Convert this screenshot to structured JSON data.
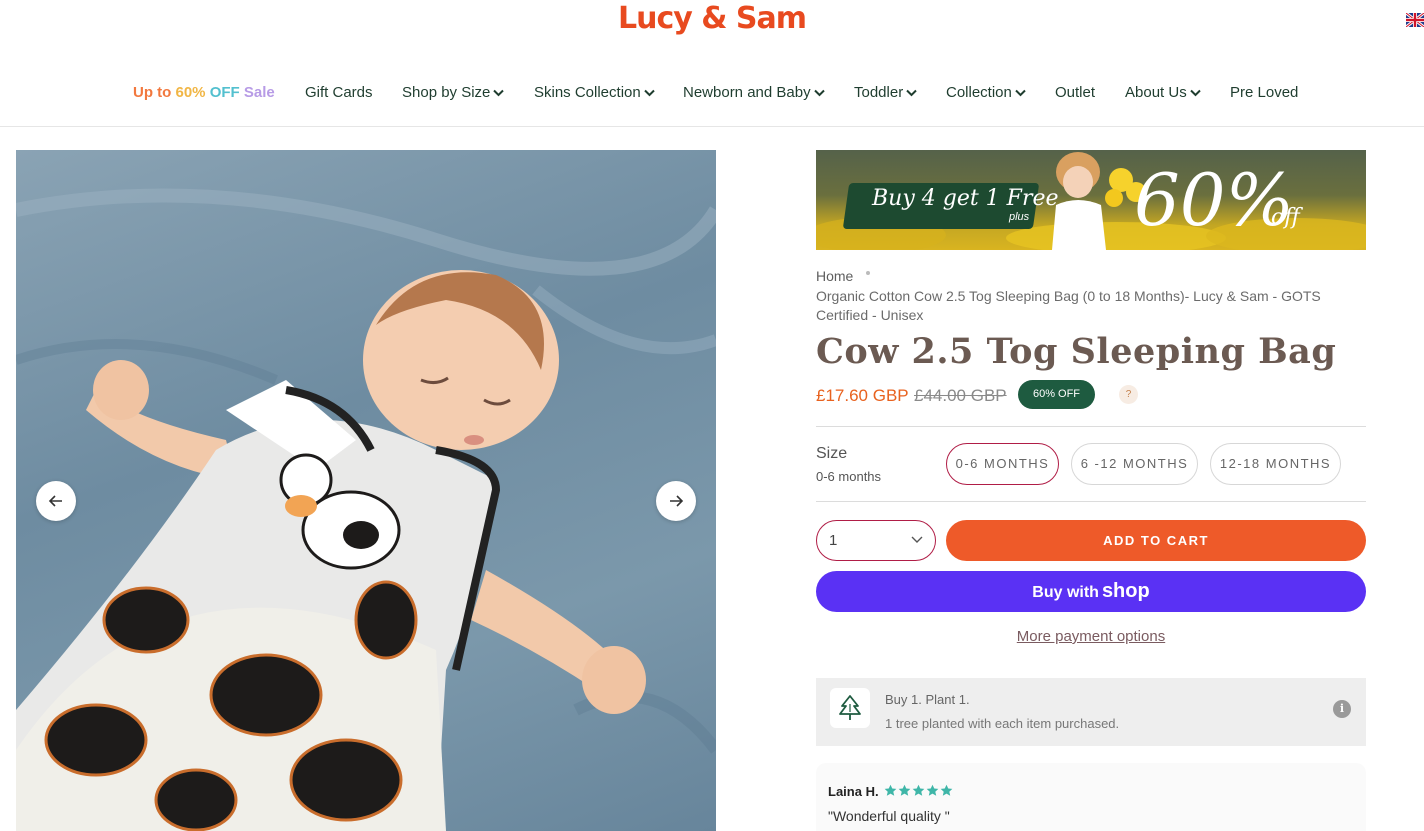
{
  "header": {
    "logo": "Lucy & Sam",
    "nav": {
      "sale_parts": [
        "Up to",
        "60%",
        "OFF",
        "Sale"
      ],
      "gift_cards": "Gift Cards",
      "shop_by_size": "Shop by Size",
      "skins_collection": "Skins Collection",
      "newborn": "Newborn and Baby",
      "toddler": "Toddler",
      "collection": "Collection",
      "outlet": "Outlet",
      "about": "About Us",
      "pre_loved": "Pre Loved"
    }
  },
  "promo": {
    "buy_text": "Buy 4 get 1 Free",
    "plus": "plus",
    "percent": "60%",
    "off": "off"
  },
  "breadcrumb": {
    "home": "Home",
    "current": "Organic Cotton Cow 2.5 Tog Sleeping Bag (0 to 18 Months)- Lucy & Sam - GOTS Certified - Unisex"
  },
  "product": {
    "title": "Cow 2.5 Tog Sleeping Bag",
    "price": "£17.60 GBP",
    "compare_price": "£44.00 GBP",
    "discount_badge": "60% OFF",
    "help": "?"
  },
  "size": {
    "label": "Size",
    "selected": "0-6 months",
    "options": [
      "0-6 MONTHS",
      "6 -12 MONTHS",
      "12-18 MONTHS"
    ]
  },
  "cart": {
    "quantity": "1",
    "add_to_cart": "ADD TO CART",
    "shop_buy": "Buy with",
    "shop_word": "shop",
    "more_payment": "More payment options"
  },
  "plant": {
    "title": "Buy 1. Plant 1.",
    "subtitle": "1 tree planted with each item purchased.",
    "info": "i"
  },
  "review": {
    "name": "Laina H.",
    "rating": 5,
    "text": "\"Wonderful quality \""
  },
  "colors": {
    "brand": "#e84a1f",
    "accent_green": "#1e5b40",
    "add_to_cart": "#ee5a29",
    "shop_pay": "#5a31f4",
    "star": "#3fb6a8"
  }
}
